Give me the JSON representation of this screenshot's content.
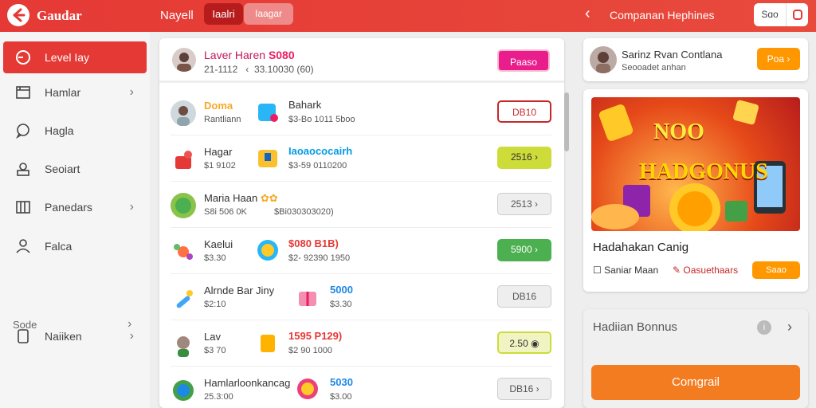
{
  "topbar": {
    "app_title": "Gaudar",
    "nav_label": "Nayell",
    "tab_active": "Iaalri",
    "tab_inactive": "Iaagar",
    "page_title": "Companan Hephines",
    "small_button": "Sɑo"
  },
  "sidebar": {
    "items": [
      {
        "label": "Level Iay",
        "icon": "clock-icon",
        "active": true,
        "chevron": false
      },
      {
        "label": "Hamlar",
        "icon": "calendar-icon",
        "active": false,
        "chevron": true
      },
      {
        "label": "Hagla",
        "icon": "chat-icon",
        "active": false,
        "chevron": false
      },
      {
        "label": "Seoiart",
        "icon": "user-card-icon",
        "active": false,
        "chevron": false
      },
      {
        "label": "Panedars",
        "icon": "columns-icon",
        "active": false,
        "chevron": true
      },
      {
        "label": "Falca",
        "icon": "person-icon",
        "active": false,
        "chevron": false
      }
    ],
    "section_label": "Sode",
    "bottom_item": {
      "label": "Naiiken",
      "icon": "document-icon",
      "chevron": true
    }
  },
  "main": {
    "header": {
      "name": "Laver Haren",
      "amount": "S080",
      "sub_left": "21-1112",
      "sub_right": "33.10030 (60)",
      "button": "Paaso"
    },
    "rows": [
      {
        "name": "Doma",
        "sub": "Rantliann",
        "gift_title": "Bahark",
        "gift_sub": "$3-Bo 1011 5boo",
        "pill": "DB10",
        "pill_style": "outline-red"
      },
      {
        "name": "Hagar",
        "sub": "$1 9102",
        "gift_title": "Iaoaococairh",
        "gift_sub": "$3-59 0110200",
        "pill": "2516",
        "pill_style": "lime"
      },
      {
        "name": "Maria Haan",
        "sub": "S8i 506 0K",
        "gift_title": "",
        "gift_sub": "$Bi030303020)",
        "pill": "2513",
        "pill_style": "gray"
      },
      {
        "name": "Kaelui",
        "sub": "$3.30",
        "gift_title": "$080 B1B)",
        "gift_sub": "$2- 92390 1950",
        "pill": "5900",
        "pill_style": "green"
      },
      {
        "name": "Alrnde Bar Jiny",
        "sub": "$2:10",
        "gift_title": "5000",
        "gift_sub": "$3.30",
        "pill": "DB16",
        "pill_style": "gray"
      },
      {
        "name": "Lav",
        "sub": "$3 70",
        "gift_title": "1595 P129)",
        "gift_sub": "$2 90 1000",
        "pill": "2.50",
        "pill_style": "lime-outline"
      },
      {
        "name": "Hamlarloonkancag",
        "sub": "25.3:00",
        "gift_title": "5030",
        "gift_sub": "$3.00",
        "pill": "DB16",
        "pill_style": "gray"
      }
    ]
  },
  "right": {
    "profile": {
      "name": "Sarinz Rvan Contlana",
      "sub": "Seooadet anhan",
      "button": "Poa"
    },
    "promo": {
      "banner_line1": "NOO",
      "banner_line2": "HADGONUS",
      "title": "Hadahakan Canig",
      "link1": "Saniar Maan",
      "link2": "Oasuethaars",
      "button": "Saao"
    },
    "bonus": {
      "title": "Hadiian Bonnus",
      "button": "Comgrail"
    }
  },
  "colors": {
    "brand": "#e53935",
    "accent_orange": "#ff9800",
    "pink": "#e91e8c",
    "green": "#4caf50",
    "lime": "#cddc39"
  }
}
